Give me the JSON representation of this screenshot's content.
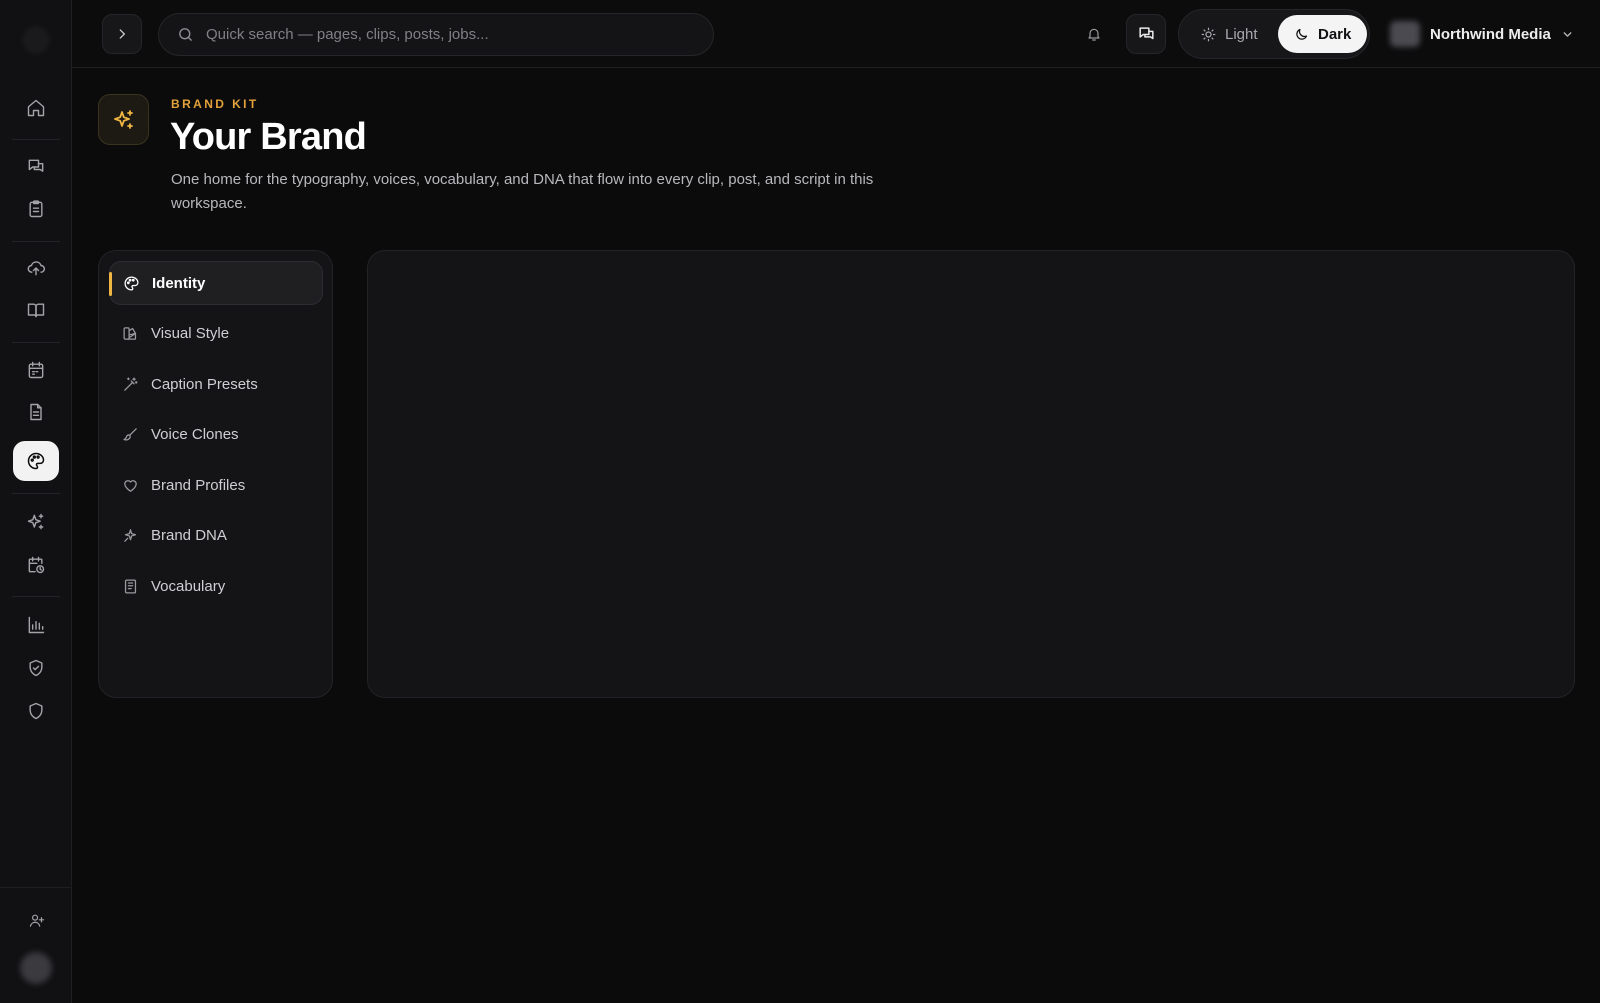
{
  "topbar": {
    "search_placeholder": "Quick search — pages, clips, posts, jobs...",
    "theme": {
      "light_label": "Light",
      "dark_label": "Dark",
      "selected": "Dark"
    },
    "workspace_name": "Northwind Media"
  },
  "header": {
    "eyebrow": "BRAND KIT",
    "title": "Your Brand",
    "description": "One home for the typography, voices, vocabulary, and DNA that flow into every clip, post, and script in this workspace."
  },
  "brand_nav": {
    "items": [
      {
        "label": "Identity",
        "icon": "palette-icon",
        "active": true
      },
      {
        "label": "Visual Style",
        "icon": "swatch-icon",
        "active": false
      },
      {
        "label": "Caption Presets",
        "icon": "magic-wand-icon",
        "active": false
      },
      {
        "label": "Voice Clones",
        "icon": "brush-icon",
        "active": false
      },
      {
        "label": "Brand Profiles",
        "icon": "heart-icon",
        "active": false
      },
      {
        "label": "Brand DNA",
        "icon": "sparkle-icon",
        "active": false
      },
      {
        "label": "Vocabulary",
        "icon": "book-icon",
        "active": false
      }
    ]
  },
  "colors": {
    "accent": "#f0b643",
    "background": "#0b0b0c",
    "card": "#141416"
  }
}
